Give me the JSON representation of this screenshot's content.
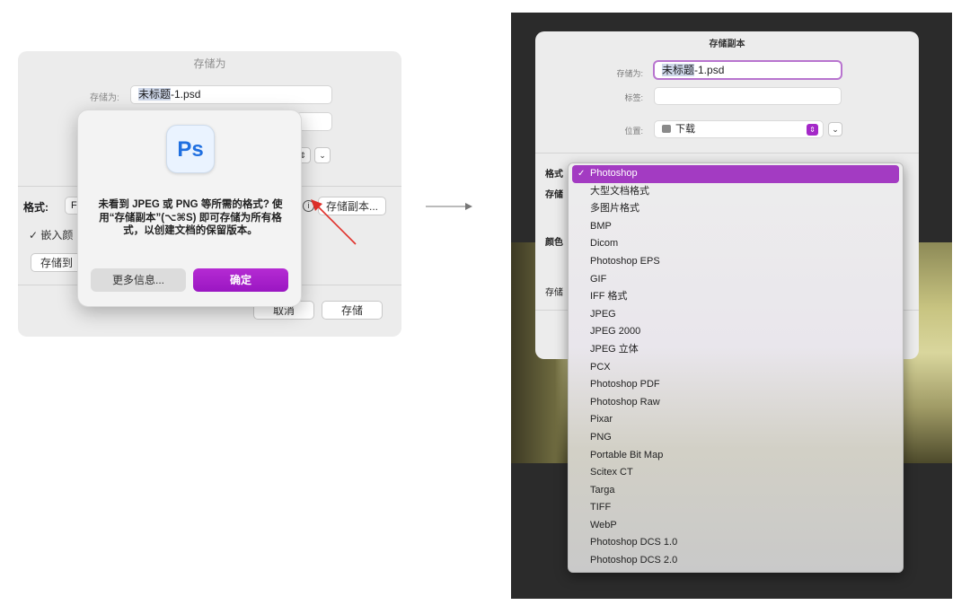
{
  "left_dialog": {
    "title": "存储为",
    "save_as_label": "存储为:",
    "filename_selected": "未标题",
    "filename_rest": "-1.psd",
    "location_arrows": "⇕",
    "chevron": "⌄",
    "format_label": "格式:",
    "format_value": "F",
    "info_icon": "i",
    "save_copy_button": "存储副本...",
    "embed_checkbox": "嵌入颜",
    "embed_checked": "✓",
    "save_to_button": "存储到",
    "cancel_button": "取消",
    "save_button": "存储"
  },
  "alert": {
    "icon_text": "Ps",
    "message": "未看到 JPEG 或 PNG 等所需的格式? 使用“存储副本”(⌥⌘S) 即可存储为所有格式，以创建文档的保留版本。",
    "more_info_button": "更多信息...",
    "ok_button": "确定"
  },
  "copy_dialog": {
    "title": "存储副本",
    "save_as_label": "存储为:",
    "filename_selected": "未标题",
    "filename_rest": "-1.psd",
    "tags_label": "标签:",
    "location_label": "位置:",
    "location_value": "下载",
    "stepper_glyph": "⇕",
    "chevron": "⌄",
    "side_label_format": "格式",
    "side_label_save": "存储",
    "side_label_color": "颜色",
    "side_label_save2": "存储",
    "accent_color": "#a33bc2"
  },
  "format_menu": {
    "check": "✓",
    "items": [
      "Photoshop",
      "大型文档格式",
      "多图片格式",
      "BMP",
      "Dicom",
      "Photoshop EPS",
      "GIF",
      "IFF 格式",
      "JPEG",
      "JPEG 2000",
      "JPEG 立体",
      "PCX",
      "Photoshop PDF",
      "Photoshop Raw",
      "Pixar",
      "PNG",
      "Portable Bit Map",
      "Scitex CT",
      "Targa",
      "TIFF",
      "WebP",
      "Photoshop DCS 1.0",
      "Photoshop DCS 2.0"
    ]
  }
}
